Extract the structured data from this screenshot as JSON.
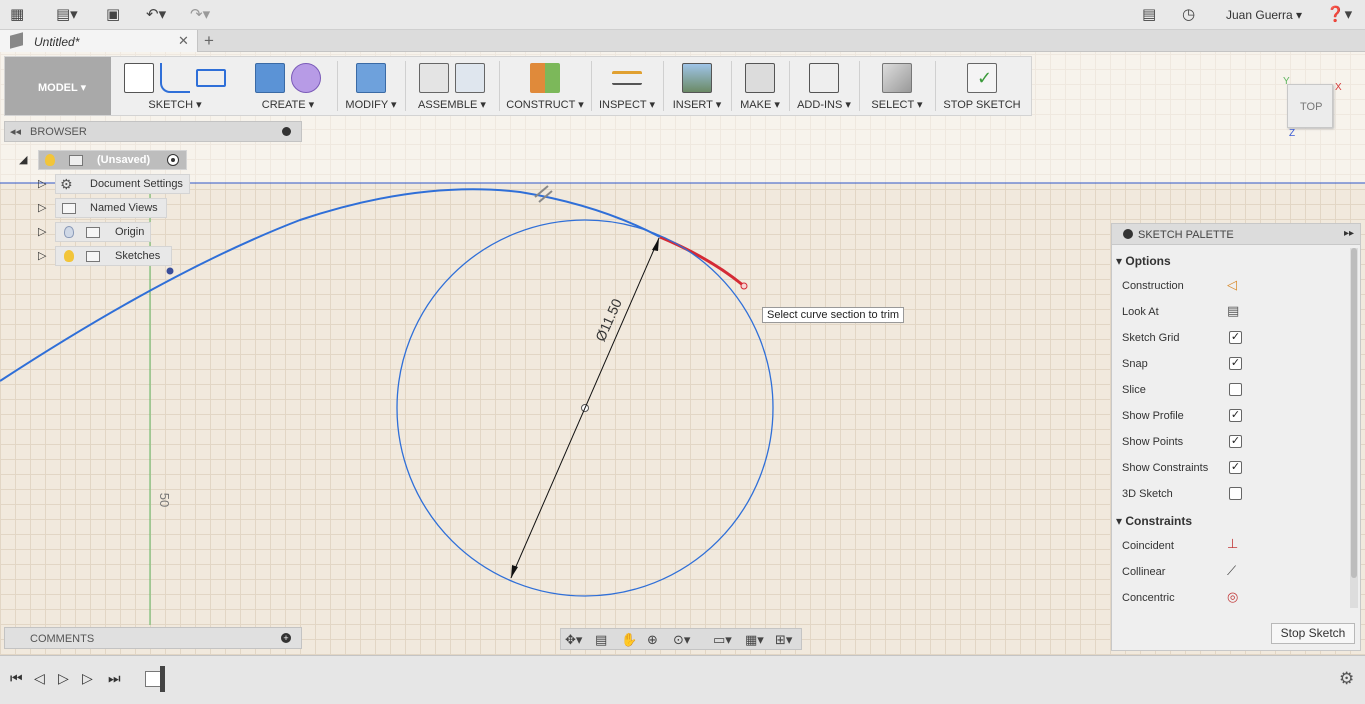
{
  "app_bar": {
    "icons": [
      "grid-icon",
      "file-icon",
      "save-icon",
      "undo-icon",
      "redo-icon",
      "comment-icon",
      "history-icon",
      "help-icon"
    ],
    "user": "Juan Guerra ▾"
  },
  "document_tab": {
    "title": "Untitled*",
    "close": "✕",
    "new_tab": "+"
  },
  "toolbar": {
    "model_label": "MODEL ▾",
    "groups": [
      {
        "label": "SKETCH ▾"
      },
      {
        "label": "CREATE ▾"
      },
      {
        "label": "MODIFY ▾"
      },
      {
        "label": "ASSEMBLE ▾"
      },
      {
        "label": "CONSTRUCT ▾"
      },
      {
        "label": "INSPECT ▾"
      },
      {
        "label": "INSERT ▾"
      },
      {
        "label": "MAKE ▾"
      },
      {
        "label": "ADD-INS ▾"
      },
      {
        "label": "SELECT ▾"
      },
      {
        "label": "STOP SKETCH"
      }
    ]
  },
  "browser": {
    "title": "BROWSER",
    "items": [
      {
        "label": "(Unsaved)"
      },
      {
        "label": "Document Settings"
      },
      {
        "label": "Named Views"
      },
      {
        "label": "Origin"
      },
      {
        "label": "Sketches"
      }
    ]
  },
  "comments": {
    "title": "COMMENTS"
  },
  "canvas": {
    "dimension_label": "Ø11.50",
    "ruler_label": "50",
    "tooltip": "Select curve section to trim",
    "curve_color": "#2f6fd8",
    "trim_color": "#d42a35"
  },
  "view_cube": {
    "face": "TOP",
    "axis_x": "X",
    "axis_y": "Y",
    "axis_z": "Z"
  },
  "sketch_palette": {
    "title": "SKETCH PALETTE",
    "options_header": "Options",
    "options": [
      {
        "label": "Construction",
        "icon": "construction-icon"
      },
      {
        "label": "Look At",
        "icon": "look-at-icon"
      },
      {
        "label": "Sketch Grid",
        "checked": true
      },
      {
        "label": "Snap",
        "checked": true
      },
      {
        "label": "Slice",
        "checked": false
      },
      {
        "label": "Show Profile",
        "checked": true
      },
      {
        "label": "Show Points",
        "checked": true
      },
      {
        "label": "Show Constraints",
        "checked": true
      },
      {
        "label": "3D Sketch",
        "checked": false
      }
    ],
    "constraints_header": "Constraints",
    "constraints": [
      {
        "label": "Coincident",
        "icon": "coincident-icon"
      },
      {
        "label": "Collinear",
        "icon": "collinear-icon"
      },
      {
        "label": "Concentric",
        "icon": "concentric-icon"
      }
    ],
    "stop_button": "Stop Sketch"
  }
}
